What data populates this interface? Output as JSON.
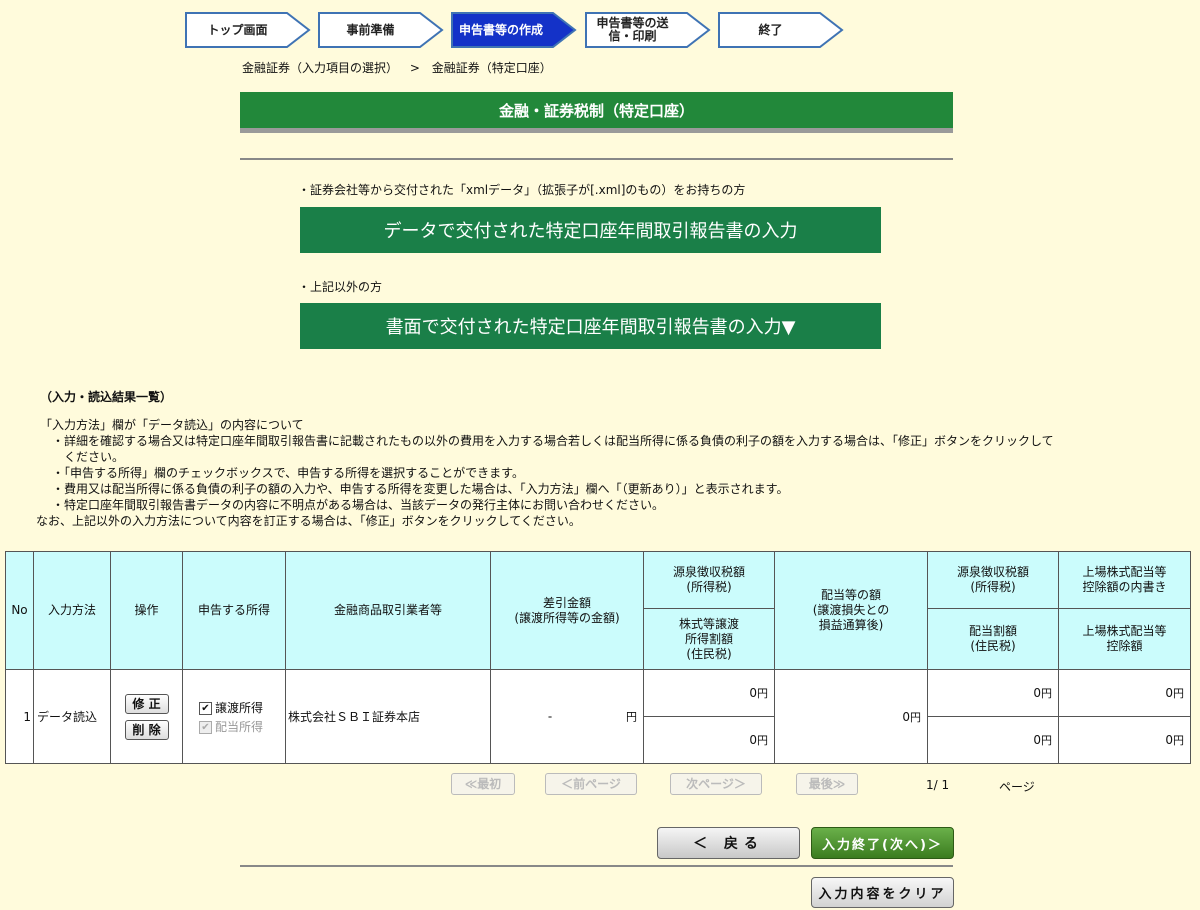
{
  "steps": [
    {
      "label": "トップ画面",
      "state": "done"
    },
    {
      "label": "事前準備",
      "state": "done"
    },
    {
      "label": "申告書等の作成",
      "state": "active"
    },
    {
      "label": "申告書等の送信・印刷",
      "state": "todo"
    },
    {
      "label": "終了",
      "state": "todo"
    }
  ],
  "breadcrumb": {
    "item1": "金融証券（入力項目の選択）",
    "sep": ">",
    "item2": "金融証券（特定口座）"
  },
  "title": "金融・証券税制（特定口座）",
  "xml_note": "・証券会社等から交付された「xmlデータ」（拡張子が[.xml]のもの）をお持ちの方",
  "data_input_button": "データで交付された特定口座年間取引報告書の入力",
  "other_note": "・上記以外の方",
  "paper_input_button": "書面で交付された特定口座年間取引報告書の入力▼",
  "result_section_title": "（入力・読込結果一覧）",
  "info": {
    "head": "「入力方法」欄が「データ読込」の内容について",
    "b1": "・詳細を確認する場合又は特定口座年間取引報告書に記載されたもの以外の費用を入力する場合若しくは配当所得に係る負債の利子の額を入力する場合は、「修正」ボタンをクリックして",
    "b1b": "ください。",
    "b2": "・「申告する所得」欄のチェックボックスで、申告する所得を選択することができます。",
    "b3": "・費用又は配当所得に係る負債の利子の額の入力や、申告する所得を変更した場合は、「入力方法」欄へ「（更新あり）」と表示されます。",
    "b4": "・特定口座年間取引報告書データの内容に不明点がある場合は、当該データの発行主体にお問い合わせください。",
    "tail": "なお、上記以外の入力方法について内容を訂正する場合は、「修正」ボタンをクリックしてください。"
  },
  "table": {
    "headers": {
      "no": "No",
      "method": "入力方法",
      "ops": "操作",
      "income": "申告する所得",
      "broker": "金融商品取引業者等",
      "diff": "差引金額\n(譲渡所得等の金額)",
      "wh1": "源泉徴収税額\n(所得税)",
      "wh1b": "株式等譲渡\n所得割額\n(住民税)",
      "div": "配当等の額\n(譲渡損失との\n損益通算後)",
      "wh2": "源泉徴収税額\n(所得税)",
      "wh2b": "配当割額\n(住民税)",
      "listed": "上場株式配当等\n控除額の内書き",
      "listedb": "上場株式配当等\n控除額"
    },
    "row": {
      "no": "1",
      "method": "データ読込",
      "edit_button": "修 正",
      "delete_button": "削 除",
      "transfer_income": "譲渡所得",
      "transfer_checked": true,
      "dividend_income": "配当所得",
      "dividend_disabled": true,
      "broker": "株式会社ＳＢＩ証券本店",
      "diff_sign": "-",
      "yen": "円",
      "wh1": "0",
      "wh1b": "0",
      "div": "0",
      "wh2": "0",
      "wh2b": "0",
      "listed": "0",
      "listedb": "0"
    }
  },
  "pager": {
    "first": "≪最初",
    "prev": "＜前ページ",
    "next": "次ページ＞",
    "last": "最後≫",
    "current": "1/ 1",
    "suffix": "ページ"
  },
  "buttons": {
    "back": "＜ 戻る",
    "next": "入力終了(次へ)＞",
    "clear": "入力内容をクリア"
  },
  "colors": {
    "background": "#fffbdc",
    "title_green": "#22883a",
    "button_green": "#1a7f48",
    "active_step": "#1432c8",
    "header_cyan": "#cbfcfc"
  }
}
